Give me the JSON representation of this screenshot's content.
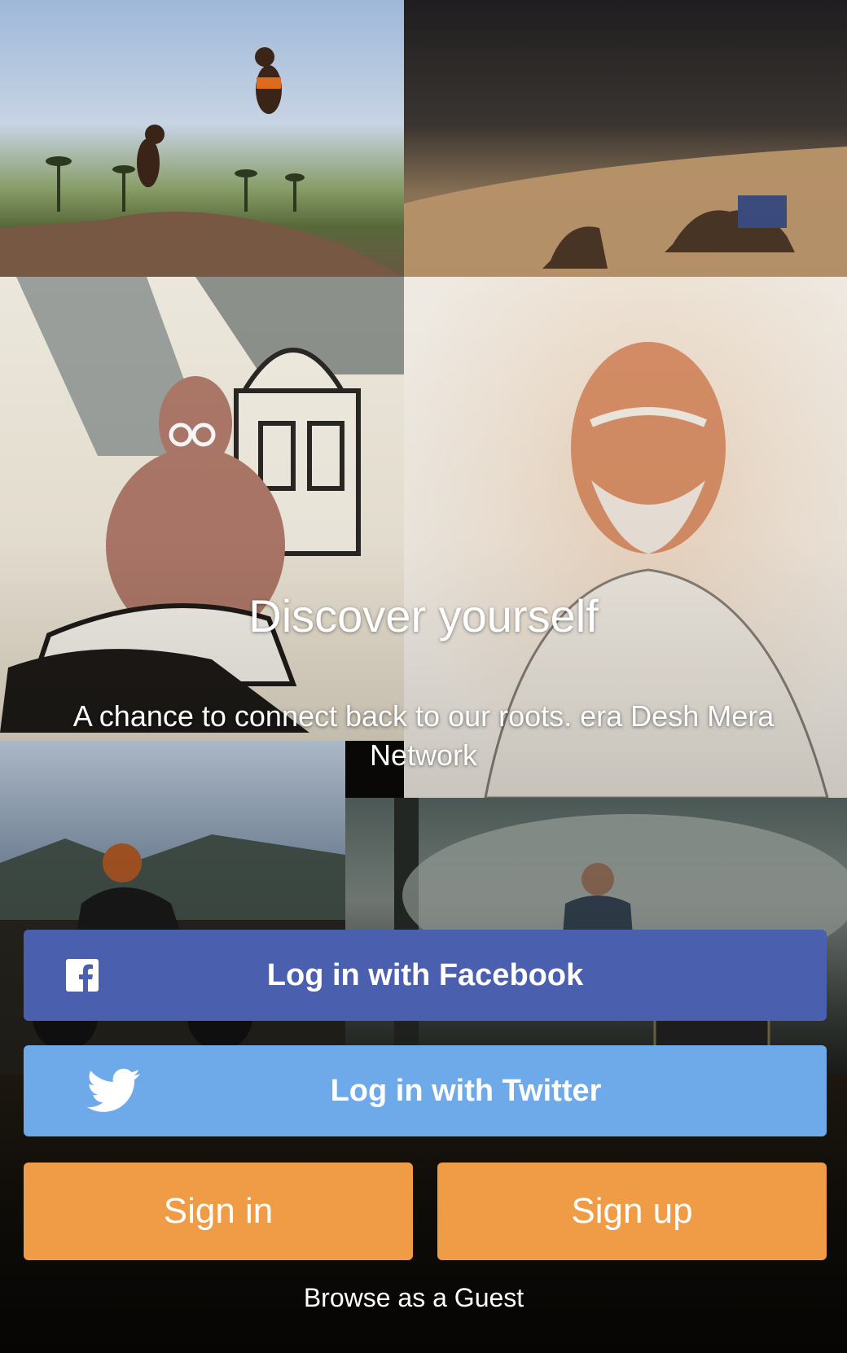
{
  "background": {
    "tiles": [
      {
        "name": "kalaripayattu-photo"
      },
      {
        "name": "desert-camel-photo"
      },
      {
        "name": "gandhi-taj-illustration"
      },
      {
        "name": "portrait-sketch-art"
      },
      {
        "name": "motorcycle-rider-photo"
      },
      {
        "name": "smoke-forest-photo"
      },
      {
        "name": "dark-bottom-photo"
      }
    ]
  },
  "hero": {
    "headline": "Discover yourself",
    "subtitle": "A chance to connect back to our roots. era Desh Mera Network"
  },
  "buttons": {
    "facebook": {
      "label": "Log in with Facebook",
      "icon": "facebook-icon",
      "color": "#4a5fae"
    },
    "twitter": {
      "label": "Log in with Twitter",
      "icon": "twitter-icon",
      "color": "#6ea9ea"
    },
    "sign_in": {
      "label": "Sign in",
      "color": "#f09b45"
    },
    "sign_up": {
      "label": "Sign up",
      "color": "#f09b45"
    }
  },
  "guest_link": "Browse as a Guest"
}
